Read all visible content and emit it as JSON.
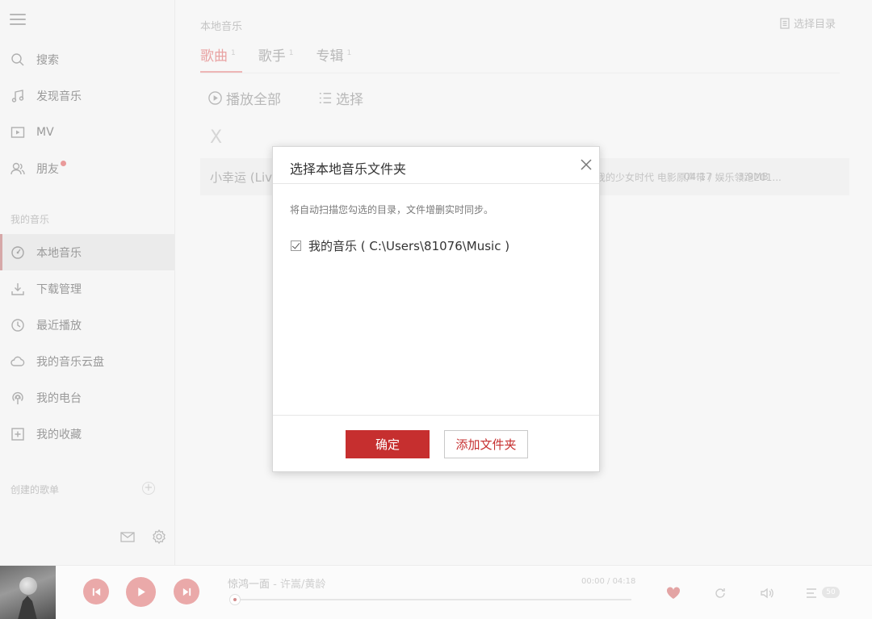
{
  "sidebar": {
    "items": [
      {
        "label": "搜索",
        "icon": "search-icon"
      },
      {
        "label": "发现音乐",
        "icon": "music-note-icon"
      },
      {
        "label": "MV",
        "icon": "video-icon"
      },
      {
        "label": "朋友",
        "icon": "friends-icon"
      }
    ],
    "my_music_title": "我的音乐",
    "my_music_items": [
      {
        "label": "本地音乐",
        "icon": "local-music-icon",
        "active": true
      },
      {
        "label": "下载管理",
        "icon": "download-icon"
      },
      {
        "label": "最近播放",
        "icon": "clock-icon"
      },
      {
        "label": "我的音乐云盘",
        "icon": "cloud-icon"
      },
      {
        "label": "我的电台",
        "icon": "radio-icon"
      },
      {
        "label": "我的收藏",
        "icon": "collection-icon"
      }
    ],
    "playlist_title": "创建的歌单",
    "add_symbol": "+"
  },
  "main": {
    "page_title": "本地音乐",
    "choose_dir_label": "选择目录",
    "tabs": [
      {
        "label": "歌曲",
        "count": "1",
        "active": true
      },
      {
        "label": "歌手",
        "count": "1"
      },
      {
        "label": "专辑",
        "count": "1"
      }
    ],
    "play_all_label": "播放全部",
    "select_label": "选择",
    "close_symbol": "X",
    "song": {
      "name": "小幸运 (Liv",
      "album": "我的少女时代 电影原声带 / 娱乐领跑201...",
      "duration": "04:17",
      "size": "3.9MB"
    }
  },
  "dialog": {
    "title": "选择本地音乐文件夹",
    "description": "将自动扫描您勾选的目录，文件增删实时同步。",
    "folder_label": "我的音乐 ( C:\\Users\\81076\\Music )",
    "folder_checked": true,
    "ok_label": "确定",
    "add_folder_label": "添加文件夹"
  },
  "player": {
    "song_title": "惊鸿一面",
    "artist": "许嵩/黄龄",
    "current_time": "00:00",
    "total_time": "04:18",
    "progress": 0,
    "playlist_count": "50",
    "accent_color": "#eaa9a9"
  }
}
